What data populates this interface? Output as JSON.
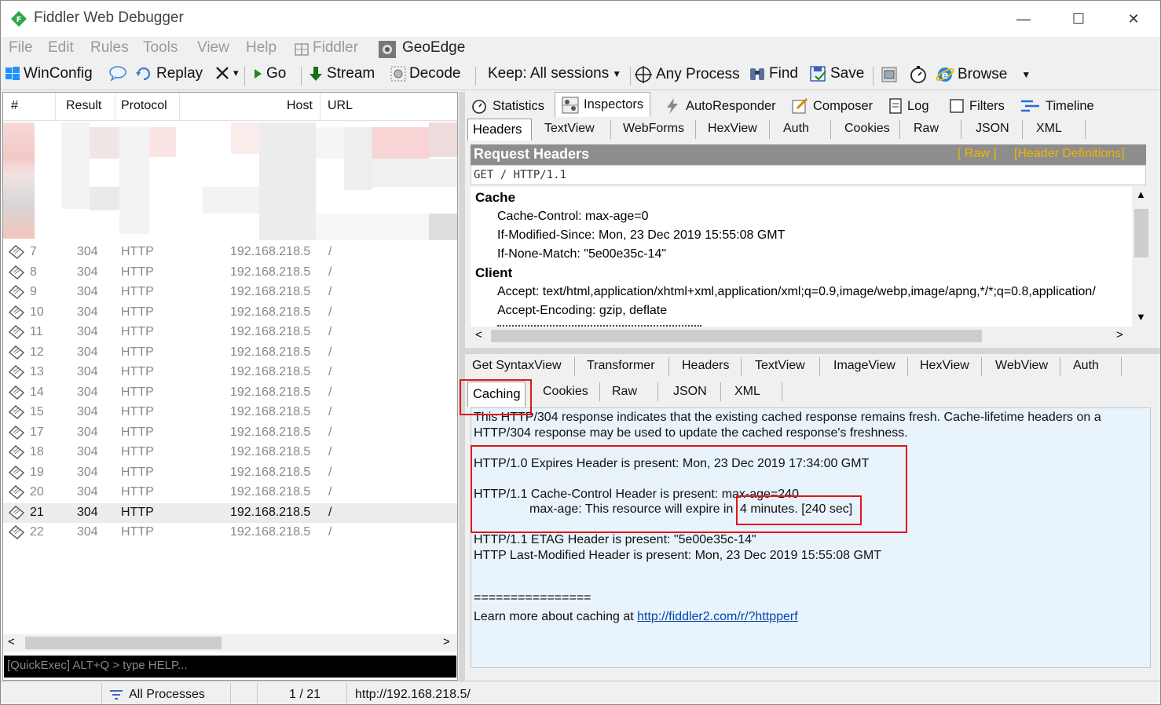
{
  "window": {
    "title": "Fiddler Web Debugger",
    "minimize": "—",
    "maximize": "☐",
    "close": "✕"
  },
  "menu": {
    "items": [
      "File",
      "Edit",
      "Rules",
      "Tools",
      "View",
      "Help",
      "Fiddler",
      "GeoEdge"
    ]
  },
  "toolbar": {
    "winconfig": "WinConfig",
    "replay": "Replay",
    "remove": "▾",
    "go": "Go",
    "stream": "Stream",
    "decode": "Decode",
    "keep": "Keep: All sessions",
    "any_process": "Any Process",
    "find": "Find",
    "save": "Save",
    "browse": "Browse"
  },
  "sessions": {
    "columns": [
      "#",
      "Result",
      "Protocol",
      "Host",
      "URL"
    ],
    "rows": [
      {
        "id": "7",
        "result": "304",
        "protocol": "HTTP",
        "host": "192.168.218.5",
        "url": "/"
      },
      {
        "id": "8",
        "result": "304",
        "protocol": "HTTP",
        "host": "192.168.218.5",
        "url": "/"
      },
      {
        "id": "9",
        "result": "304",
        "protocol": "HTTP",
        "host": "192.168.218.5",
        "url": "/"
      },
      {
        "id": "10",
        "result": "304",
        "protocol": "HTTP",
        "host": "192.168.218.5",
        "url": "/"
      },
      {
        "id": "11",
        "result": "304",
        "protocol": "HTTP",
        "host": "192.168.218.5",
        "url": "/"
      },
      {
        "id": "12",
        "result": "304",
        "protocol": "HTTP",
        "host": "192.168.218.5",
        "url": "/"
      },
      {
        "id": "13",
        "result": "304",
        "protocol": "HTTP",
        "host": "192.168.218.5",
        "url": "/"
      },
      {
        "id": "14",
        "result": "304",
        "protocol": "HTTP",
        "host": "192.168.218.5",
        "url": "/"
      },
      {
        "id": "15",
        "result": "304",
        "protocol": "HTTP",
        "host": "192.168.218.5",
        "url": "/"
      },
      {
        "id": "17",
        "result": "304",
        "protocol": "HTTP",
        "host": "192.168.218.5",
        "url": "/"
      },
      {
        "id": "18",
        "result": "304",
        "protocol": "HTTP",
        "host": "192.168.218.5",
        "url": "/"
      },
      {
        "id": "19",
        "result": "304",
        "protocol": "HTTP",
        "host": "192.168.218.5",
        "url": "/"
      },
      {
        "id": "20",
        "result": "304",
        "protocol": "HTTP",
        "host": "192.168.218.5",
        "url": "/"
      },
      {
        "id": "21",
        "result": "304",
        "protocol": "HTTP",
        "host": "192.168.218.5",
        "url": "/",
        "selected": true
      },
      {
        "id": "22",
        "result": "304",
        "protocol": "HTTP",
        "host": "192.168.218.5",
        "url": "/"
      }
    ]
  },
  "quickexec": {
    "placeholder": "[QuickExec] ALT+Q > type HELP..."
  },
  "top_tabs": [
    "Statistics",
    "Inspectors",
    "AutoResponder",
    "Composer",
    "Log",
    "Filters",
    "Timeline"
  ],
  "request_tabs": [
    "Headers",
    "TextView",
    "WebForms",
    "HexView",
    "Auth",
    "Cookies",
    "Raw",
    "JSON",
    "XML"
  ],
  "request_headers": {
    "title": "Request Headers",
    "raw_link": "[ Raw ]",
    "defs_link": "[Header Definitions]",
    "request_line": "GET / HTTP/1.1",
    "groups": [
      {
        "name": "Cache",
        "items": [
          "Cache-Control: max-age=0",
          "If-Modified-Since: Mon, 23 Dec 2019 15:55:08 GMT",
          "If-None-Match: \"5e00e35c-14\""
        ]
      },
      {
        "name": "Client",
        "items": [
          "Accept: text/html,application/xhtml+xml,application/xml;q=0.9,image/webp,image/apng,*/*;q=0.8,application/",
          "Accept-Encoding: gzip, deflate"
        ]
      }
    ]
  },
  "response_tabs_row1": [
    "Get SyntaxView",
    "Transformer",
    "Headers",
    "TextView",
    "ImageView",
    "HexView",
    "WebView",
    "Auth"
  ],
  "response_tabs_row2": [
    "Caching",
    "Cookies",
    "Raw",
    "JSON",
    "XML"
  ],
  "caching": {
    "intro1": "This HTTP/304 response indicates that the existing cached response remains fresh. Cache-lifetime headers on a",
    "intro2": "HTTP/304 response may be used to update the cached response's freshness.",
    "expires": "HTTP/1.0 Expires Header is present: Mon, 23 Dec 2019 17:34:00 GMT",
    "cache_control": "HTTP/1.1 Cache-Control Header is present: max-age=240",
    "max_age_prefix": "max-age: This resource will expire in ",
    "max_age_value": "4 minutes. [240 sec]",
    "etag": "HTTP/1.1 ETAG Header is present: \"5e00e35c-14\"",
    "last_modified": "HTTP Last-Modified Header is present: Mon, 23 Dec 2019 15:55:08 GMT",
    "divider": "================",
    "learn_more": "Learn more about caching at ",
    "learn_more_link": "http://fiddler2.com/r/?httpperf"
  },
  "status": {
    "processes": "All Processes",
    "count": "1 / 21",
    "url": "http://192.168.218.5/"
  }
}
